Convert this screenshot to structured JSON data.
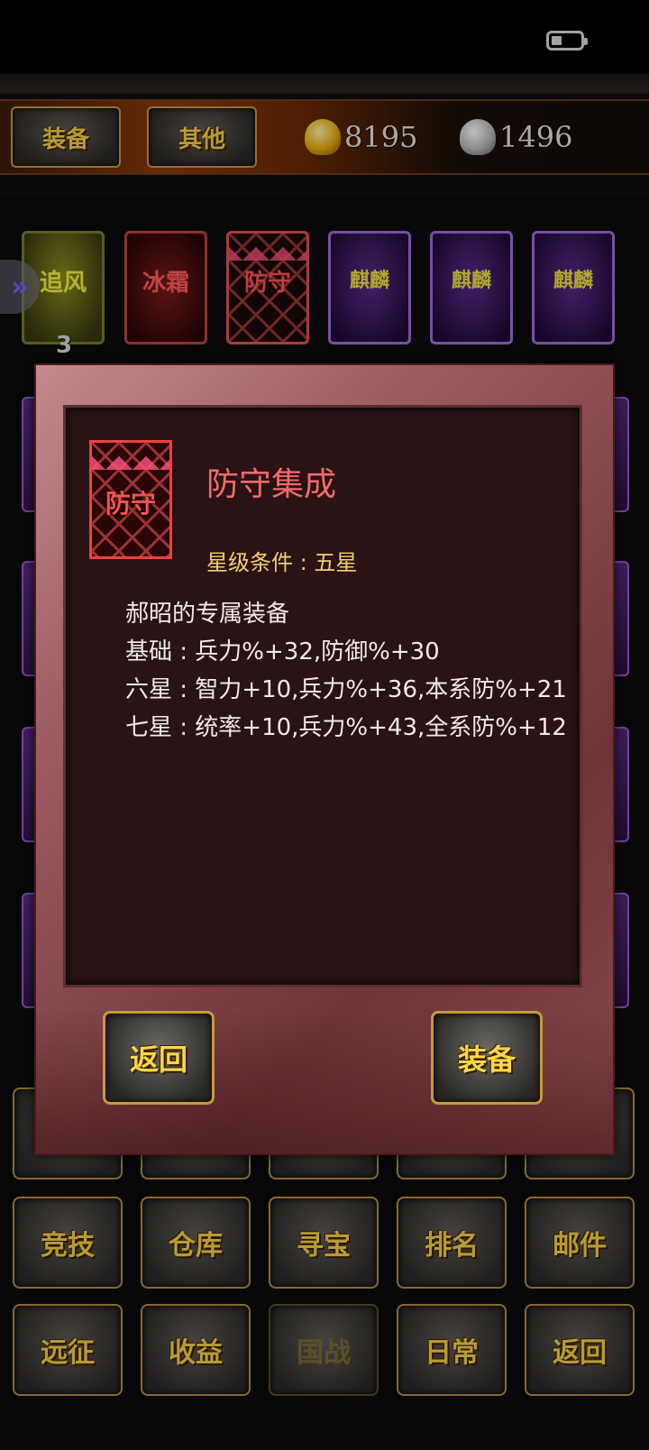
{
  "status_bar": {
    "battery_icon": "battery-icon",
    "battery_level": 0.35
  },
  "top_bar": {
    "tabs": [
      "装备",
      "其他"
    ],
    "gold": {
      "icon": "gold-ingot-icon",
      "value": "8195"
    },
    "silver": {
      "icon": "silver-ingot-icon",
      "value": "1496"
    }
  },
  "equipment_cards": [
    {
      "label": "追风",
      "style": "yellow"
    },
    {
      "label": "冰霜",
      "style": "red"
    },
    {
      "label": "防守",
      "style": "pink"
    },
    {
      "label": "麒麟",
      "style": "purple"
    },
    {
      "label": "麒麟",
      "style": "purple"
    },
    {
      "label": "麒麟",
      "style": "purple"
    }
  ],
  "first_card_count": "3",
  "bottom_grid": {
    "row2": [
      "竞技",
      "仓库",
      "寻宝",
      "排名",
      "邮件"
    ],
    "row3": [
      "远征",
      "收益",
      "国战",
      "日常",
      "返回"
    ]
  },
  "dialog": {
    "icon_label": "防守",
    "title": "防守集成",
    "star_condition": "星级条件 : 五星",
    "description": [
      "郝昭的专属装备",
      "基础 : 兵力%+32,防御%+30",
      "六星 : 智力+10,兵力%+36,本系防%+21",
      "七星 : 统率+10,兵力%+43,全系防%+12"
    ],
    "back_button": "返回",
    "equip_button": "装备"
  },
  "colors": {
    "accent_gold": "#f3d046",
    "title_red": "#f46a6a",
    "star_yellow": "#f4d06a"
  }
}
